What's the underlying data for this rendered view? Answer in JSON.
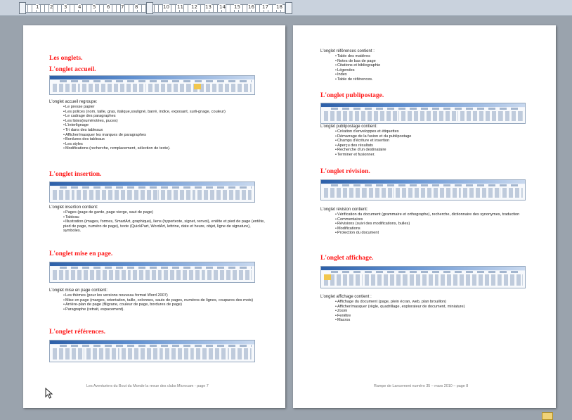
{
  "left_page": {
    "title": "Les onglets.",
    "sections": [
      {
        "heading": "L'onglet accueil.",
        "intro": "L'onglet accueil  regroupe:",
        "items": [
          "Le presse papier",
          "Les polices (nom, taille, gras, italique,souligné, barré, indice, exposant, surli-gnage, couleur)",
          "Le cadrage des paragraphes",
          "Les listes(numérotées, puces)",
          "L'interlignage",
          "Tri dans des tableaux",
          "Afficher/masquer les marques de paragraphes",
          "Bordures des tableaux",
          "Les styles",
          "Modifications (recherche, remplacement, sélection de texte)."
        ]
      },
      {
        "heading": "L'onglet insertion.",
        "intro": "L'onglet insertion contient:",
        "items": [
          "Pages (page de garde, page vierge, saut de page)",
          "Tableau",
          "Illustration (images, formes, SmartArt, graphique), liens (hypertexte, signet, renvoi), entête et pied de page (entête, pied de page, numéro de page), texte (QuickPart, WordArt, lettrine, date et heure, objet, ligne de signature), symboles."
        ]
      },
      {
        "heading": "L'onglet mise en page.",
        "intro": "L'onglet mise en page contient:",
        "items": [
          "Les thèmes (pour les versions nouveau format Word 2007)",
          "Mise en page (marges, orientation, taille, colonnes, sauts de pages, numéros de lignes, coupures des mots)",
          "Arrière-plan de page (filigrane, couleur de page, bordures de page)",
          "Paragraphe (retrait, espacement)."
        ]
      },
      {
        "heading": "L'onglet références.",
        "intro": "",
        "items": []
      }
    ],
    "footer": "Les Aventuriers du Bout du Monde la revue des clubs Microcam - page 7"
  },
  "right_page": {
    "sections": [
      {
        "heading": "",
        "intro": "L'onglet références contient :",
        "items": [
          "Table des matières",
          "Notes de bas de page",
          "Citations et bibliographie",
          "Légendes",
          "Index",
          "Table de références."
        ]
      },
      {
        "heading": "L'onglet publipostage.",
        "intro": "L'onglet publipostage contient:",
        "items": [
          "Création d'enveloppes et étiquettes",
          "Démarrage de la fusion et du publipostage",
          "Champs d'écriture et insertion",
          "Aperçu des résultats",
          "Recherche d'un destinataire",
          "Terminer et fusionner."
        ]
      },
      {
        "heading": "L'onglet révision.",
        "intro": "L'onglet révision contient:",
        "items": [
          "Vérification du document (grammaire et orthographe), recherche, dictionnaire des synonymes, traduction",
          "Commentaires",
          "Révisions (suivi des modifications, bulles)",
          "Modifications",
          "Protection du document"
        ]
      },
      {
        "heading": "L'onglet affichage.",
        "intro": "L'onglet affichage contient :",
        "items": [
          "Affichage du document (page, plein écran, web, plan brouillon)",
          "Afficher/masquer (règle, quadrillage, explorateur de document, miniature)",
          "Zoom",
          "Fenêtre",
          "Macros"
        ]
      }
    ],
    "footer": "Rampe de Lancement numéro 35 – mars 2010 – page 8"
  },
  "ruler": {
    "numbers": [
      "1",
      "2",
      "3",
      "4",
      "5",
      "6",
      "7",
      "8",
      "9",
      "10",
      "11",
      "12",
      "13",
      "14",
      "15",
      "16",
      "17",
      "18"
    ]
  },
  "icons": {
    "cursor": "mouse-pointer-icon",
    "zoom": "zoom-icon"
  },
  "colors": {
    "heading": "#ff1a1a",
    "workspace": "#9aa3ad",
    "ruler": "#c9d2dd"
  }
}
